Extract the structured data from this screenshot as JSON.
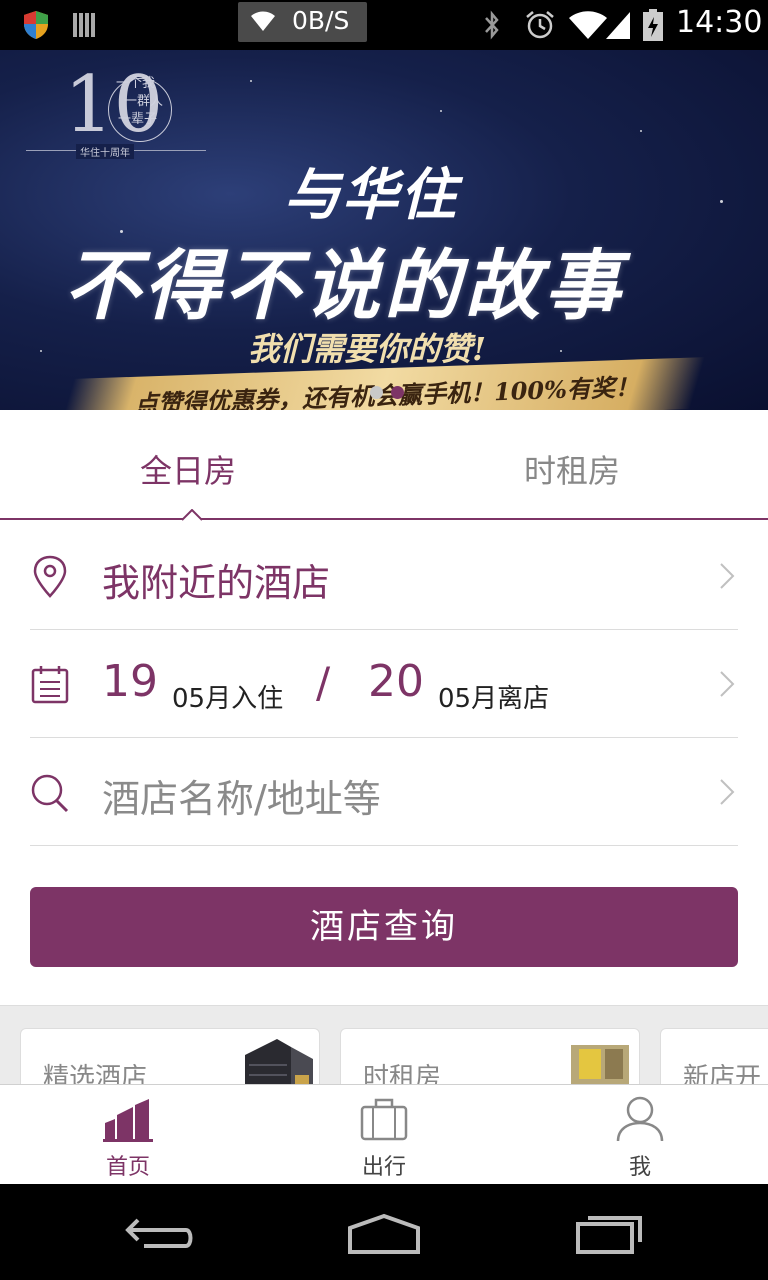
{
  "status_bar": {
    "net_speed": "0B/S",
    "time": "14:30",
    "icons": [
      "shield-icon",
      "bars-icon",
      "wifi-icon",
      "bluetooth-icon",
      "alarm-icon",
      "wifi-icon",
      "signal-icon",
      "battery-icon"
    ]
  },
  "banner": {
    "anniversary_badge": {
      "number": "10",
      "line1": "一个我",
      "line2": "一群人",
      "line3": "一辈子",
      "subtitle": "华住十周年"
    },
    "title1": "与华住",
    "title2": "不得不说的故事",
    "title3": "我们需要你的赞!",
    "ribbon": "点赞得优惠券，还有机会赢手机！100%有奖！",
    "page_dots": {
      "count": 2,
      "active": 2
    }
  },
  "tabs": [
    {
      "label": "全日房",
      "active": true
    },
    {
      "label": "时租房",
      "active": false
    }
  ],
  "form": {
    "nearby_label": "我附近的酒店",
    "checkin_day": "19",
    "checkin_label": "05月入住",
    "separator": "/",
    "checkout_day": "20",
    "checkout_label": "05月离店",
    "search_placeholder": "酒店名称/地址等",
    "query_button": "酒店查询"
  },
  "cards": [
    {
      "label": "精选酒店"
    },
    {
      "label": "时租房"
    },
    {
      "label": "新店开"
    }
  ],
  "bottom_nav": [
    {
      "label": "首页",
      "icon": "buildings-icon",
      "active": true
    },
    {
      "label": "出行",
      "icon": "suitcase-icon",
      "active": false
    },
    {
      "label": "我",
      "icon": "person-icon",
      "active": false
    }
  ],
  "colors": {
    "accent": "#7d3466",
    "divider": "#dcdcdc",
    "placeholder": "#8a8a8a"
  }
}
